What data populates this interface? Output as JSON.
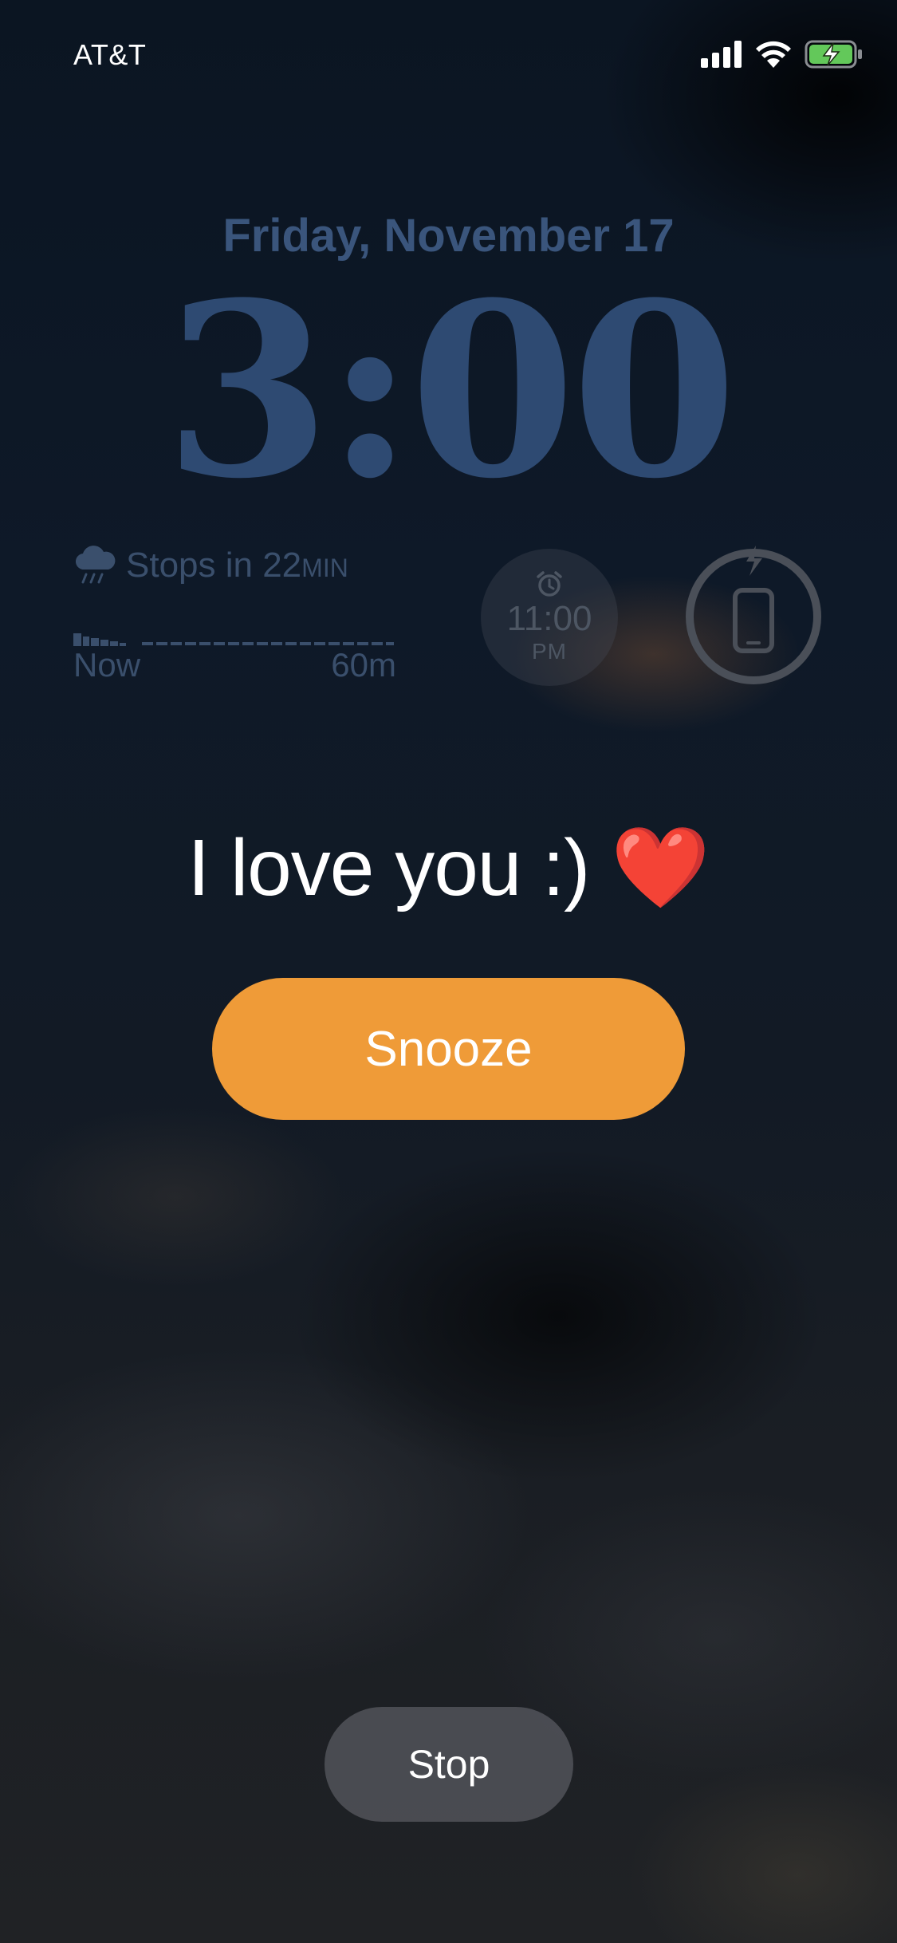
{
  "status_bar": {
    "carrier": "AT&T",
    "signal_icon": "cellular-signal-icon",
    "wifi_icon": "wifi-icon",
    "battery_icon": "battery-charging-icon"
  },
  "lock_screen": {
    "date": "Friday, November 17",
    "time": "3:00"
  },
  "widgets": {
    "weather": {
      "icon": "rain-cloud-icon",
      "text": "Stops in 22",
      "unit": "MIN",
      "start_label": "Now",
      "end_label": "60m"
    },
    "alarm": {
      "icon": "alarm-clock-icon",
      "time": "11:00",
      "ampm": "PM"
    },
    "battery": {
      "icon": "phone-charging-icon"
    }
  },
  "alarm_alert": {
    "message": "I love you :) ❤️",
    "snooze_label": "Snooze",
    "stop_label": "Stop"
  },
  "colors": {
    "snooze": "#ef9b38",
    "date_text": "#3a557c",
    "clock_text": "#2e4a72"
  }
}
